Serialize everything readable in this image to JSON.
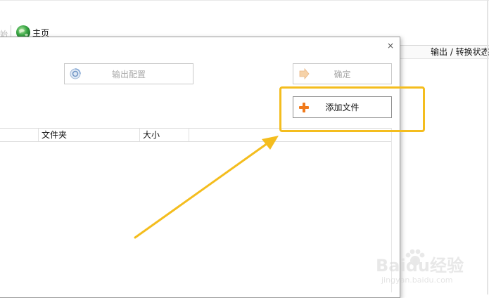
{
  "background_window": {
    "toolbar": {
      "faded_text": "始",
      "home_label": "主页"
    },
    "column_header": "输出 / 转换状态"
  },
  "dialog": {
    "close_glyph": "×",
    "output_config_label": "输出配置",
    "ok_label": "确定",
    "add_file_label": "添加文件",
    "table": {
      "columns": [
        "",
        "文件夹",
        "大小",
        ""
      ]
    }
  },
  "annotation": {
    "highlight_color": "#f4bd1e",
    "arrow_color": "#f4bd1e"
  },
  "watermark": {
    "main": "Baidu经验",
    "sub": "jingyan.baidu.com"
  },
  "colors": {
    "add_icon": "#f07a1c",
    "disabled_text": "#a8a8a8",
    "globe": "#2e9a3a"
  }
}
